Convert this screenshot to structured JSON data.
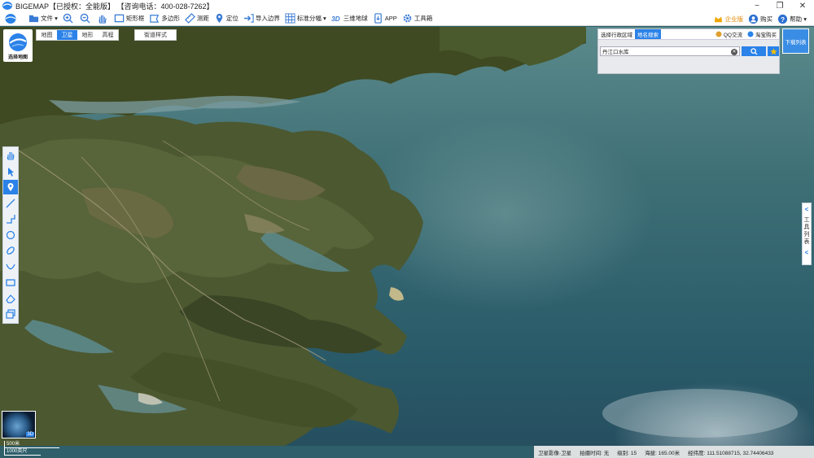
{
  "window": {
    "title": "BIGEMAP【已授权：全能版】   【咨询电话：400-028-7262】",
    "controls": {
      "minimize": "−",
      "maximize": "❐",
      "close": "✕"
    }
  },
  "toolbar": {
    "items": [
      {
        "label": "文件 ▾",
        "icon": "folder-icon"
      },
      {
        "label": "",
        "icon": "zoom-in-icon"
      },
      {
        "label": "",
        "icon": "zoom-out-icon"
      },
      {
        "label": "",
        "icon": "hand-icon"
      },
      {
        "label": "矩形框",
        "icon": "rectangle-icon"
      },
      {
        "label": "多边形",
        "icon": "polygon-icon"
      },
      {
        "label": "测距",
        "icon": "ruler-icon"
      },
      {
        "label": "定位",
        "icon": "location-pin-icon"
      },
      {
        "label": "导入边界",
        "icon": "import-icon"
      },
      {
        "label": "标准分幅 ▾",
        "icon": "grid-icon"
      },
      {
        "label": "三维地球",
        "icon": "3d-icon"
      },
      {
        "label": "APP",
        "icon": "app-icon"
      },
      {
        "label": "工具箱",
        "icon": "gear-icon"
      }
    ],
    "right": {
      "enterprise": "企业版",
      "purchase": "购买",
      "help": "帮助 ▾"
    }
  },
  "map_panel": {
    "logo_label": "选择地图",
    "map_types": [
      "地图",
      "卫星",
      "地形",
      "高程"
    ],
    "active_map_type": "卫星",
    "street_style": "街道样式"
  },
  "search_panel": {
    "tabs": [
      "选择行政区域",
      "地名搜索"
    ],
    "active_tab": "地名搜索",
    "links": [
      "QQ交流",
      "淘宝购买"
    ],
    "query": "丹江口水库",
    "clear": "✕"
  },
  "download_list": "下载列表",
  "toolbox_tab": {
    "label": [
      "工",
      "具",
      "列",
      "表"
    ],
    "arrow_top": "<",
    "arrow_bottom": "<"
  },
  "minimap": {
    "label": "3D"
  },
  "scale": {
    "metric": "500米",
    "imperial": "1000英尺"
  },
  "status": {
    "source": "卫星影像·卫星",
    "capture_time": "拍摄时间: 无",
    "level": "级别: 15",
    "altitude": "海拔: 165.00米",
    "lnglat": "经纬度: 111.51088715, 32.74406433"
  },
  "colors": {
    "accent": "#2b82e8",
    "water": "#2e5f6a",
    "land": "#4d5a2e",
    "enterprise": "#e08a00"
  }
}
